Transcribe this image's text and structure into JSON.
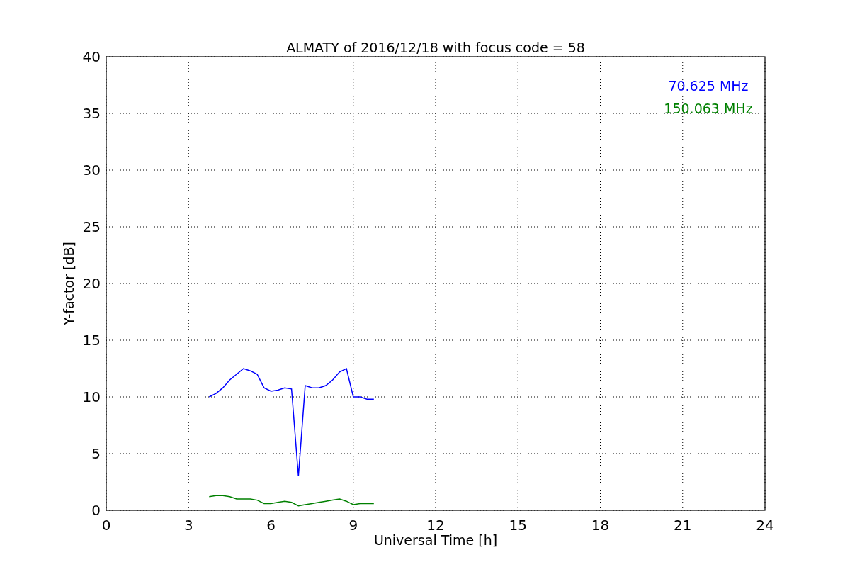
{
  "chart_data": {
    "type": "line",
    "title": "ALMATY of 2016/12/18 with focus code = 58",
    "xlabel": "Universal Time [h]",
    "ylabel": "Y-factor [dB]",
    "x": [
      3.75,
      4.0,
      4.25,
      4.5,
      4.75,
      5.0,
      5.25,
      5.5,
      5.75,
      6.0,
      6.25,
      6.5,
      6.75,
      7.0,
      7.25,
      7.5,
      7.75,
      8.0,
      8.25,
      8.5,
      8.75,
      9.0,
      9.25,
      9.5,
      9.75
    ],
    "series": [
      {
        "name": "70.625 MHz",
        "color": "#0000ff",
        "values": [
          10,
          10.3,
          10.8,
          11.5,
          12,
          12.5,
          12.3,
          12,
          10.8,
          10.5,
          10.6,
          10.8,
          10.7,
          3,
          11,
          10.8,
          10.8,
          11,
          11.5,
          12.2,
          12.5,
          10,
          10,
          9.8,
          9.8
        ]
      },
      {
        "name": "150.063 MHz",
        "color": "#008000",
        "values": [
          1.2,
          1.3,
          1.3,
          1.2,
          1.0,
          1.0,
          1.0,
          0.9,
          0.6,
          0.6,
          0.7,
          0.8,
          0.7,
          0.4,
          0.5,
          0.6,
          0.7,
          0.8,
          0.9,
          1.0,
          0.8,
          0.5,
          0.6,
          0.6,
          0.6
        ]
      }
    ],
    "xlim": [
      0,
      24
    ],
    "ylim": [
      0,
      40
    ],
    "xticks": [
      0,
      3,
      6,
      9,
      12,
      15,
      18,
      21,
      24
    ],
    "yticks": [
      0,
      5,
      10,
      15,
      20,
      25,
      30,
      35,
      40
    ],
    "grid": true
  }
}
